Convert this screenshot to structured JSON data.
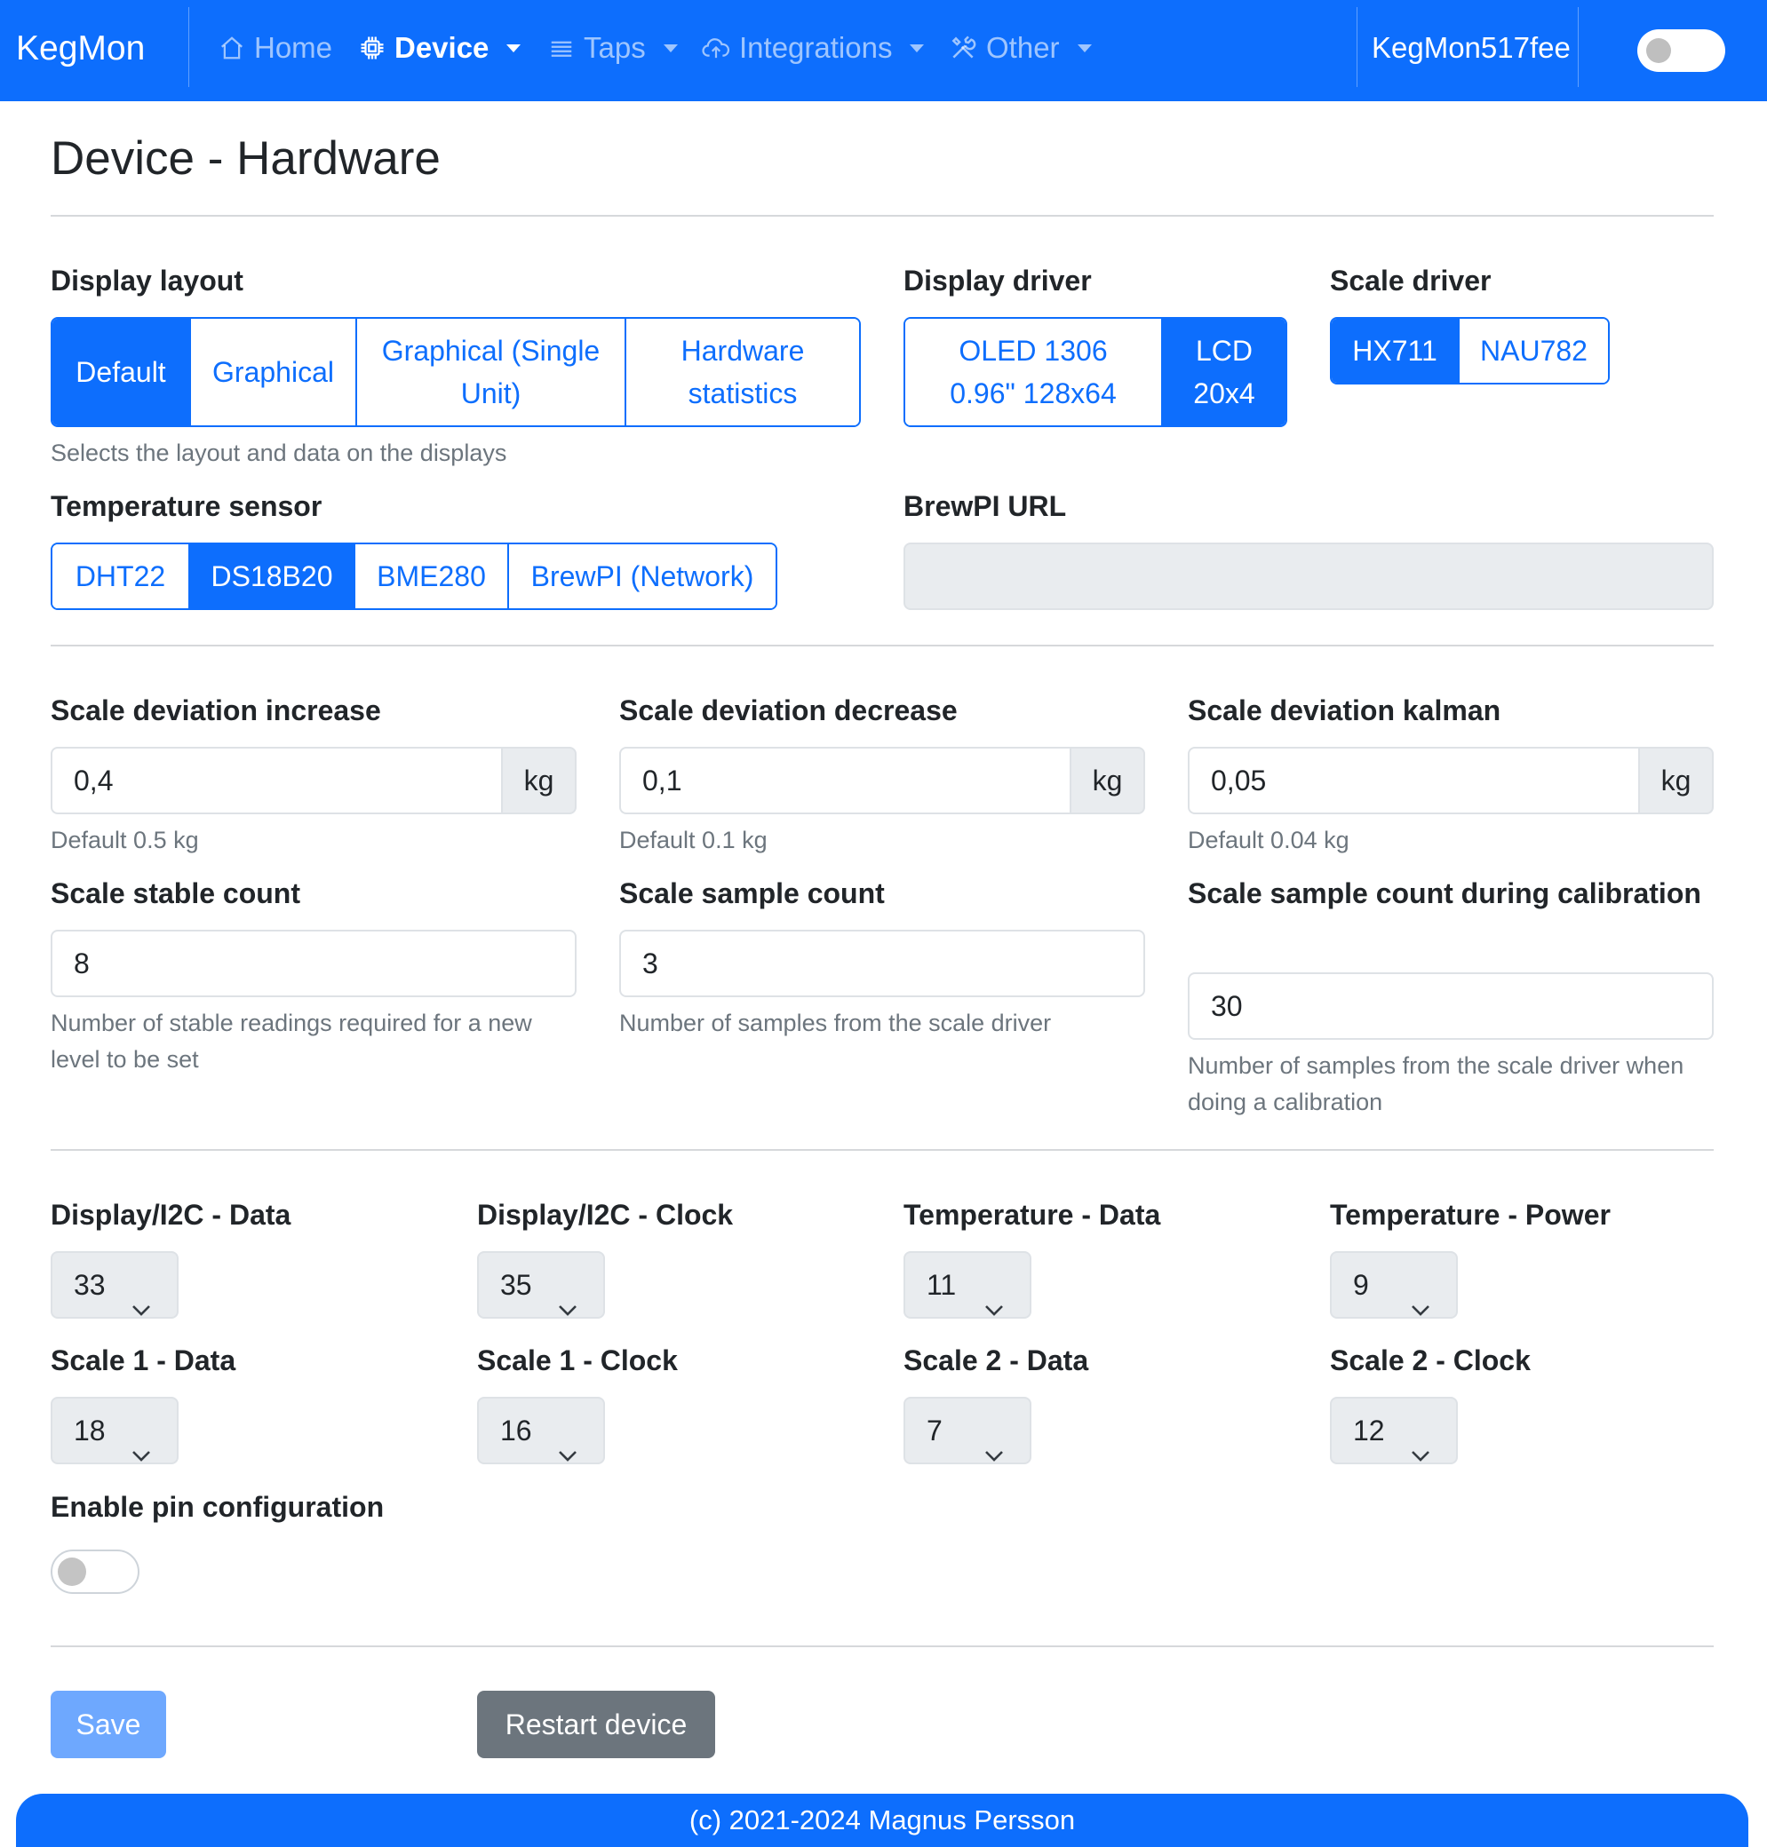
{
  "navbar": {
    "brand": "KegMon",
    "items": [
      {
        "label": "Home",
        "icon": "home-icon"
      },
      {
        "label": "Device",
        "icon": "chip-icon"
      },
      {
        "label": "Taps",
        "icon": "list-icon"
      },
      {
        "label": "Integrations",
        "icon": "cloud-upload-icon"
      },
      {
        "label": "Other",
        "icon": "tools-icon"
      }
    ],
    "hostname": "KegMon517fee"
  },
  "page": {
    "title": "Device - Hardware"
  },
  "display_layout": {
    "label": "Display layout",
    "options": [
      "Default",
      "Graphical",
      "Graphical (Single Unit)",
      "Hardware statistics"
    ],
    "selected": "Default",
    "help": "Selects the layout and data on the displays"
  },
  "display_driver": {
    "label": "Display driver",
    "options": [
      "OLED 1306 0.96\" 128x64",
      "LCD 20x4"
    ],
    "selected": "LCD 20x4"
  },
  "scale_driver": {
    "label": "Scale driver",
    "options": [
      "HX711",
      "NAU782"
    ],
    "selected": "HX711"
  },
  "temperature_sensor": {
    "label": "Temperature sensor",
    "options": [
      "DHT22",
      "DS18B20",
      "BME280",
      "BrewPI (Network)"
    ],
    "selected": "DS18B20"
  },
  "brewpi_url": {
    "label": "BrewPI URL",
    "value": ""
  },
  "scale_deviation_increase": {
    "label": "Scale deviation increase",
    "value": "0,4",
    "unit": "kg",
    "help": "Default 0.5 kg"
  },
  "scale_deviation_decrease": {
    "label": "Scale deviation decrease",
    "value": "0,1",
    "unit": "kg",
    "help": "Default 0.1 kg"
  },
  "scale_deviation_kalman": {
    "label": "Scale deviation kalman",
    "value": "0,05",
    "unit": "kg",
    "help": "Default 0.04 kg"
  },
  "scale_stable_count": {
    "label": "Scale stable count",
    "value": "8",
    "help": "Number of stable readings required for a new level to be set"
  },
  "scale_sample_count": {
    "label": "Scale sample count",
    "value": "3",
    "help": "Number of samples from the scale driver"
  },
  "scale_sample_count_calibration": {
    "label": "Scale sample count during calibration",
    "value": "30",
    "help": "Number of samples from the scale driver when doing a calibration"
  },
  "pins": {
    "display_i2c_data": {
      "label": "Display/I2C - Data",
      "value": "33"
    },
    "display_i2c_clock": {
      "label": "Display/I2C - Clock",
      "value": "35"
    },
    "temperature_data": {
      "label": "Temperature - Data",
      "value": "11"
    },
    "temperature_power": {
      "label": "Temperature - Power",
      "value": "9"
    },
    "scale1_data": {
      "label": "Scale 1 - Data",
      "value": "18"
    },
    "scale1_clock": {
      "label": "Scale 1 - Clock",
      "value": "16"
    },
    "scale2_data": {
      "label": "Scale 2 - Data",
      "value": "7"
    },
    "scale2_clock": {
      "label": "Scale 2 - Clock",
      "value": "12"
    }
  },
  "enable_pin_config": {
    "label": "Enable pin configuration",
    "enabled": false
  },
  "buttons": {
    "save": "Save",
    "restart": "Restart device"
  },
  "footer": "(c) 2021-2024 Magnus Persson",
  "colors": {
    "primary": "#0d6efd",
    "secondary": "#6c757d",
    "save_disabled": "#6ea8fe"
  }
}
